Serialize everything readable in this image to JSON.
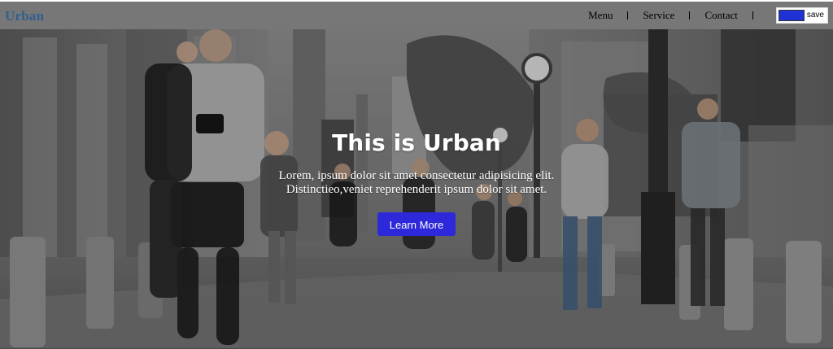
{
  "brand": {
    "text": "Urban"
  },
  "nav": {
    "items": [
      "Menu",
      "Service",
      "Contact"
    ],
    "save_label": "save"
  },
  "hero": {
    "title": "This is Urban",
    "line1": "Lorem, ipsum dolor sit amet consectetur adipisicing elit.",
    "line2": "Distinctieo,veniet reprehenderit ipsum dolor sit amet.",
    "button": "Learn More",
    "background_icon": "city-street-crowd-image"
  },
  "colors": {
    "navbar_bg": "#777777",
    "brand_text": "#315f8f",
    "button_bg": "#2d28d9",
    "save_swatch": "#1f32d6"
  }
}
